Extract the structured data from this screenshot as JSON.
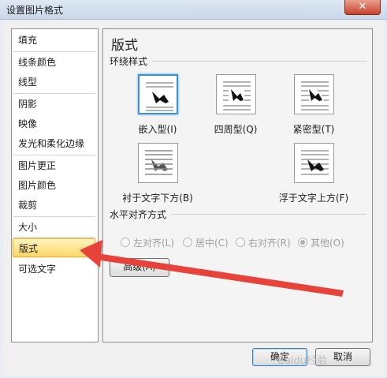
{
  "window": {
    "title": "设置图片格式",
    "close_glyph": "✕"
  },
  "nav": {
    "items": [
      "填充",
      "线条颜色",
      "线型",
      "阴影",
      "映像",
      "发光和柔化边缘",
      "图片更正",
      "图片颜色",
      "裁剪",
      "大小",
      "版式",
      "可选文字"
    ],
    "selected": "版式"
  },
  "panel": {
    "title": "版式",
    "wrap_group_label": "环绕样式",
    "wrap_options": [
      {
        "label": "嵌入型(I)",
        "icon": "inline-wrap-icon",
        "selected": true
      },
      {
        "label": "四周型(Q)",
        "icon": "square-wrap-icon",
        "selected": false
      },
      {
        "label": "紧密型(T)",
        "icon": "tight-wrap-icon",
        "selected": false
      },
      {
        "label": "衬于文字下方(B)",
        "icon": "behind-text-icon",
        "selected": false
      },
      {
        "label": "浮于文字上方(F)",
        "icon": "in-front-text-icon",
        "selected": false
      }
    ],
    "align_group_label": "水平对齐方式",
    "align_options": [
      {
        "label": "左对齐(L)",
        "checked": false
      },
      {
        "label": "居中(C)",
        "checked": false
      },
      {
        "label": "右对齐(R)",
        "checked": false
      },
      {
        "label": "其他(O)",
        "checked": true
      }
    ],
    "advanced_label": "高级(A)"
  },
  "buttons": {
    "ok": "确定",
    "cancel": "取消"
  },
  "annotation": {
    "arrow_color": "#e8433a"
  },
  "watermark": "Baidu经验"
}
